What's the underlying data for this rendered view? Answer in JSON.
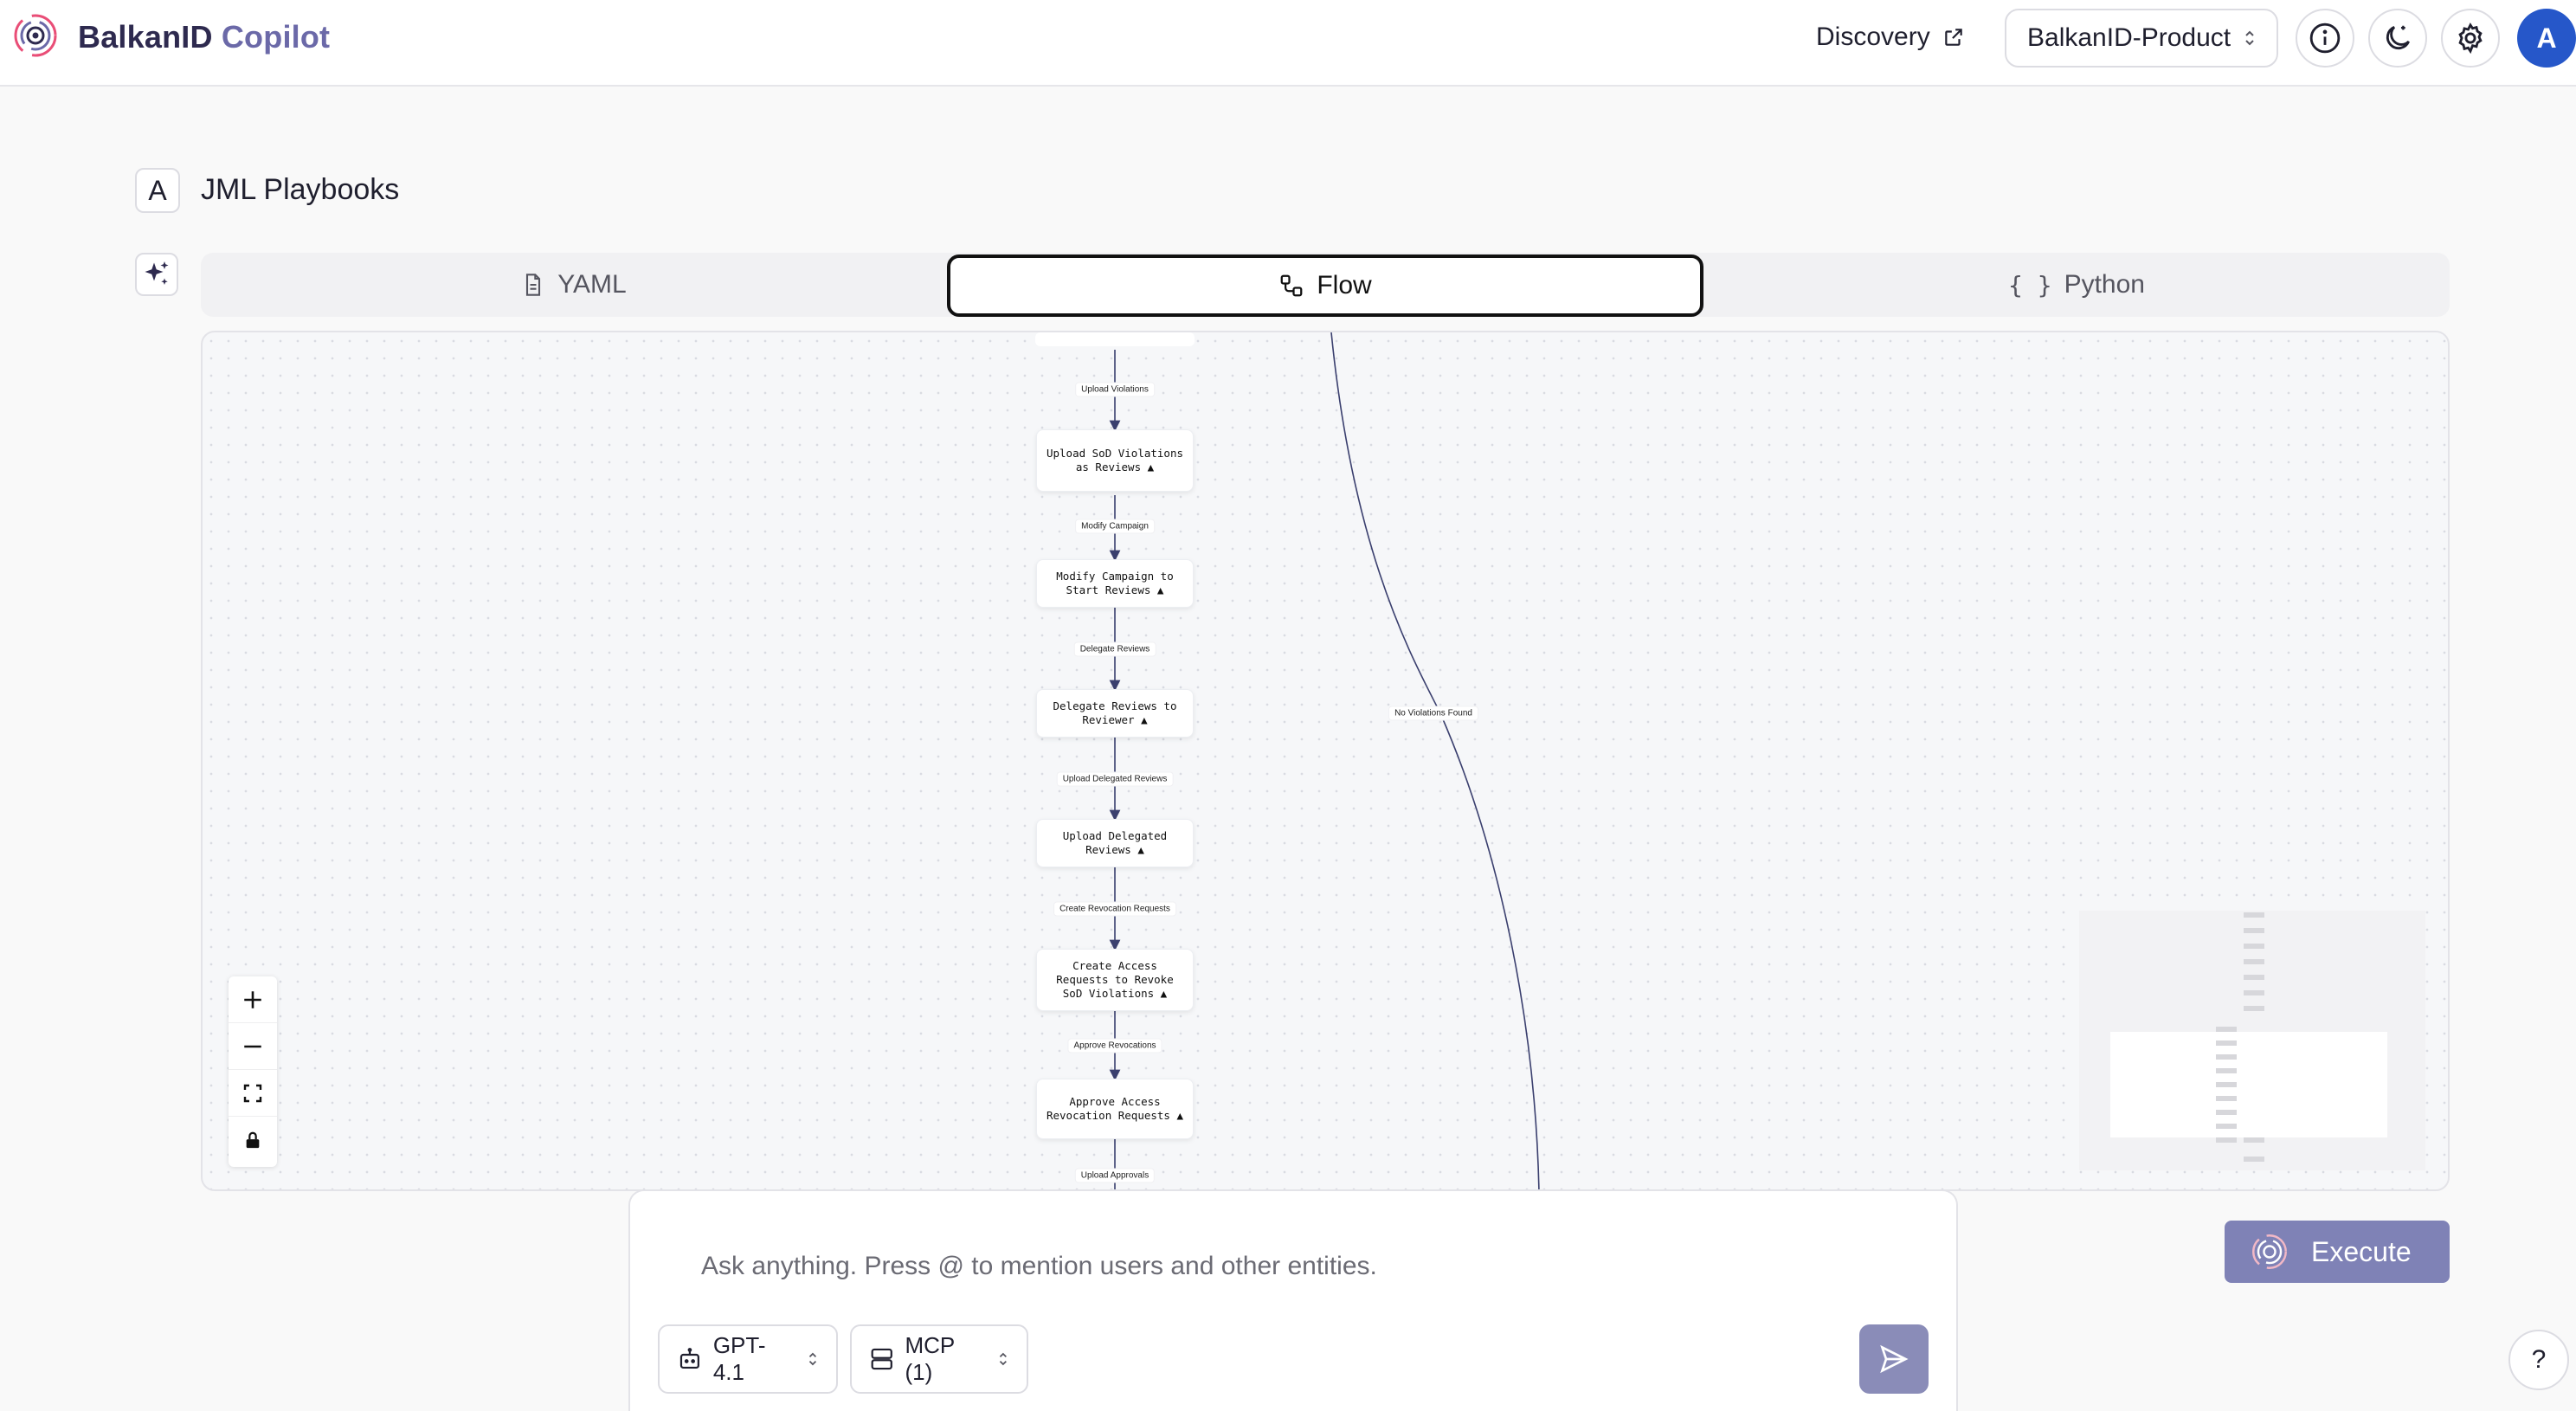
{
  "header": {
    "brand_primary": "BalkanID",
    "brand_secondary": "Copilot",
    "discovery_label": "Discovery",
    "workspace_name": "BalkanID-Product",
    "avatar_initial": "A"
  },
  "page": {
    "title_badge": "A",
    "title": "JML Playbooks"
  },
  "tabs": [
    {
      "label": "YAML",
      "icon": "document-icon",
      "active": false
    },
    {
      "label": "Flow",
      "icon": "flow-icon",
      "active": true
    },
    {
      "label": "Python",
      "icon": "braces-icon",
      "active": false
    }
  ],
  "flow": {
    "nodes": [
      {
        "id": "upload-sod",
        "label": "Upload SoD Violations as Reviews ▲"
      },
      {
        "id": "modify-campaign",
        "label": "Modify Campaign to Start Reviews ▲"
      },
      {
        "id": "delegate-reviews",
        "label": "Delegate Reviews to Reviewer ▲"
      },
      {
        "id": "upload-delegated",
        "label": "Upload Delegated Reviews ▲"
      },
      {
        "id": "create-access",
        "label": "Create Access Requests to Revoke SoD Violations ▲"
      },
      {
        "id": "approve-access",
        "label": "Approve Access Revocation Requests ▲"
      }
    ],
    "edge_labels": [
      "Upload Violations",
      "Modify Campaign",
      "Delegate Reviews",
      "Upload Delegated Reviews",
      "Create Revocation Requests",
      "Approve Revocations",
      "Upload Approvals",
      "No Violations Found"
    ]
  },
  "chat": {
    "placeholder": "Ask anything. Press @ to mention users and other entities.",
    "model": "GPT-4.1",
    "mcp": "MCP (1)"
  },
  "actions": {
    "execute_label": "Execute",
    "help_label": "?"
  },
  "colors": {
    "brand_dark": "#2e2a4f",
    "brand_accent": "#6b69a8",
    "avatar_bg": "#2657c9",
    "execute_bg": "#7f82b6",
    "send_bg": "#8a8cb8",
    "edge_color": "#3a3f6e"
  }
}
